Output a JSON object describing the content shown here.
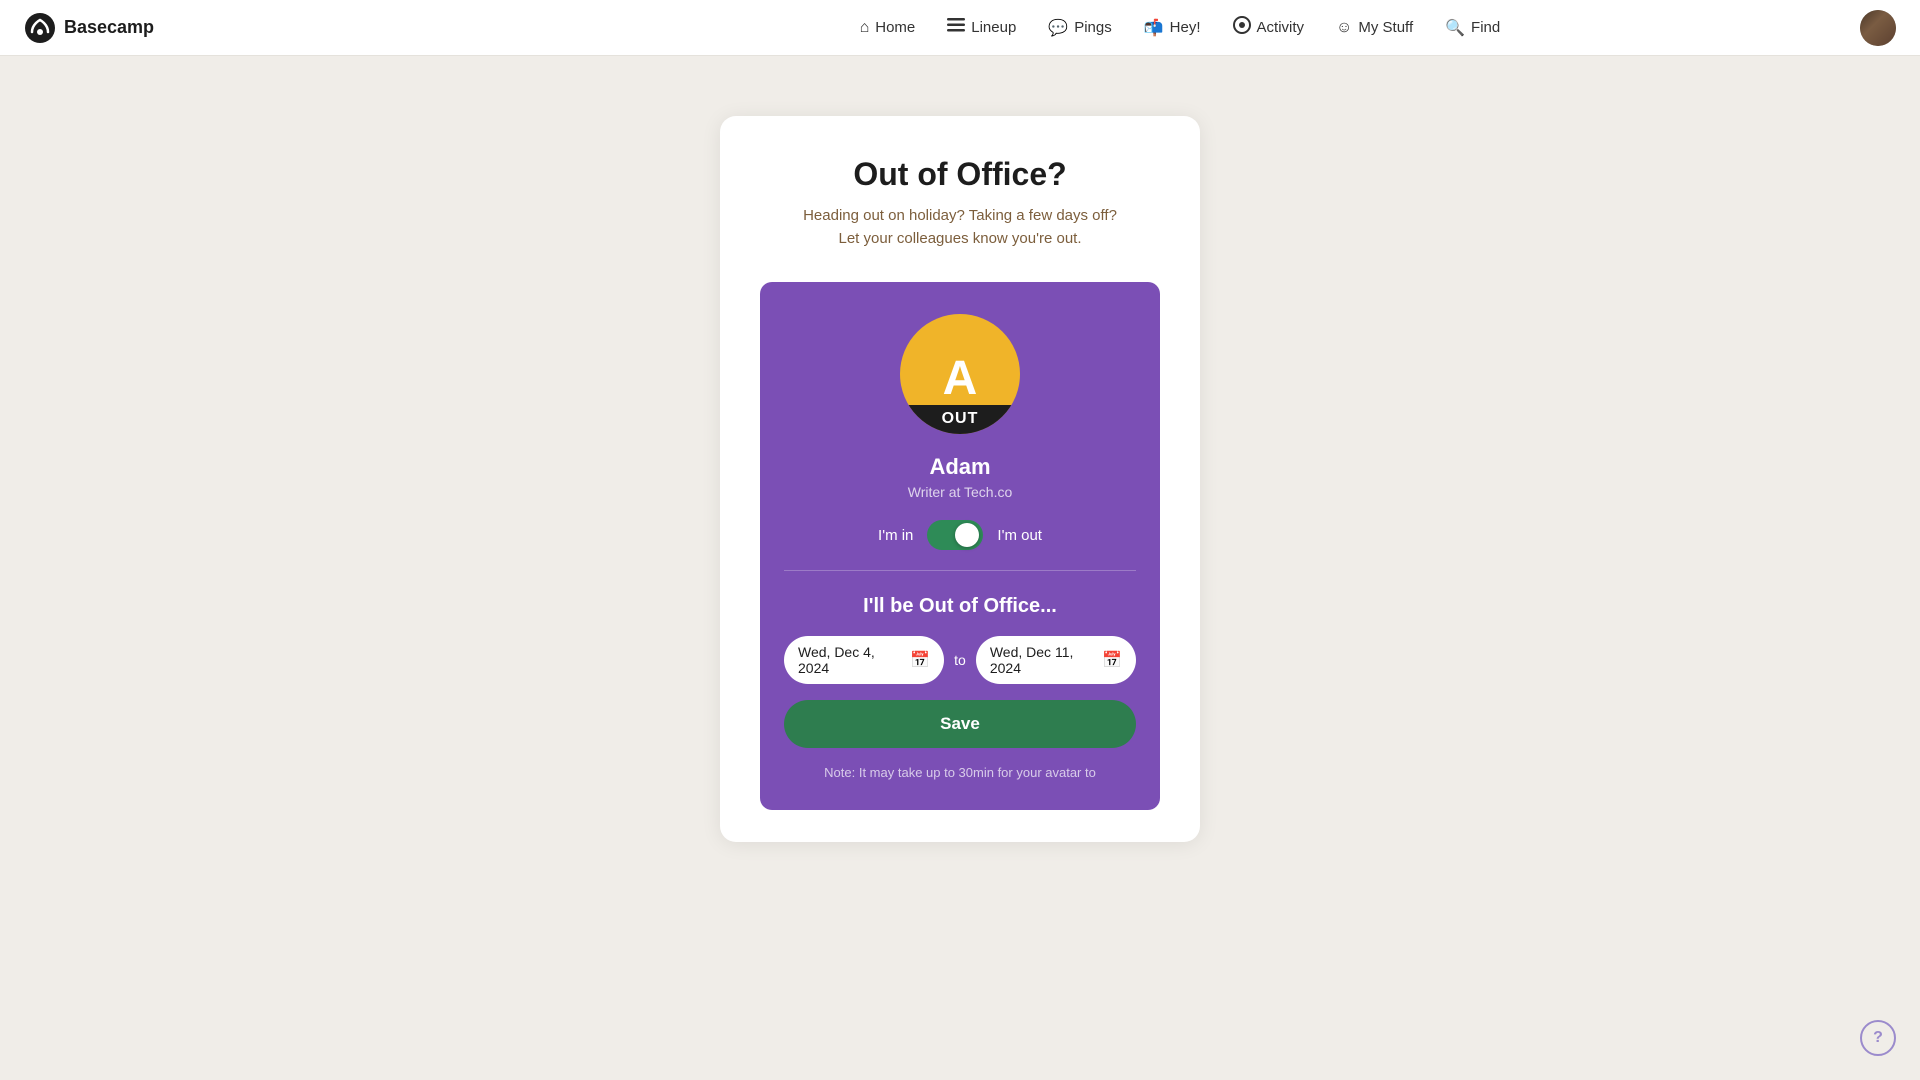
{
  "nav": {
    "logo_text": "Basecamp",
    "links": [
      {
        "id": "home",
        "label": "Home",
        "icon": "⌂"
      },
      {
        "id": "lineup",
        "label": "Lineup",
        "icon": "≡"
      },
      {
        "id": "pings",
        "label": "Pings",
        "icon": "💬"
      },
      {
        "id": "hey",
        "label": "Hey!",
        "icon": "📬"
      },
      {
        "id": "activity",
        "label": "Activity",
        "icon": "●"
      },
      {
        "id": "mystuff",
        "label": "My Stuff",
        "icon": "☺"
      },
      {
        "id": "find",
        "label": "Find",
        "icon": "🔍"
      }
    ]
  },
  "card": {
    "title": "Out of Office?",
    "subtitle_line1": "Heading out on holiday? Taking a few days off?",
    "subtitle_line2": "Let your colleagues know you're out.",
    "user": {
      "initial": "A",
      "out_label": "OUT",
      "name": "Adam",
      "role": "Writer at Tech.co"
    },
    "toggle": {
      "left_label": "I'm in",
      "right_label": "I'm out",
      "checked": true
    },
    "ooo_section": {
      "title": "I'll be Out of Office...",
      "start_date": "Wed, Dec 4, 2024",
      "to_label": "to",
      "end_date": "Wed, Dec 11, 2024"
    },
    "save_button_label": "Save",
    "note_text": "Note: It may take up to 30min for your avatar to"
  },
  "help": {
    "label": "?"
  }
}
